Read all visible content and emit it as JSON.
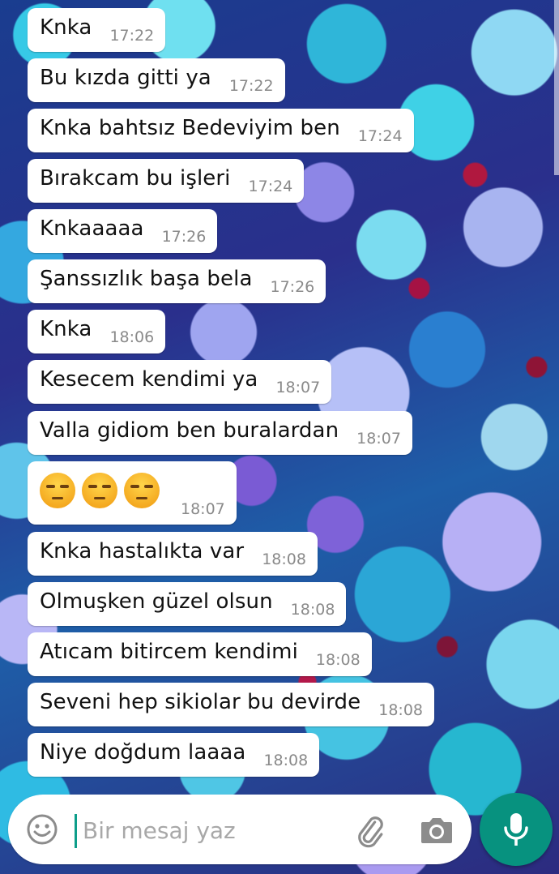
{
  "messages": [
    {
      "text": "Knka",
      "time": "17:22"
    },
    {
      "text": "Bu kızda gitti ya",
      "time": "17:22"
    },
    {
      "text": "Knka bahtsız Bedeviyim ben",
      "time": "17:24"
    },
    {
      "text": "Bırakcam bu işleri",
      "time": "17:24"
    },
    {
      "text": "Knkaaaaa",
      "time": "17:26"
    },
    {
      "text": "Şanssızlık başa bela",
      "time": "17:26"
    },
    {
      "text": "Knka",
      "time": "18:06"
    },
    {
      "text": "Kesecem kendimi ya",
      "time": "18:07"
    },
    {
      "text": "Valla gidiom ben buralardan",
      "time": "18:07"
    },
    {
      "text": "",
      "time": "18:07",
      "emoji": [
        "unamused-face",
        "unamused-face",
        "unamused-face"
      ]
    },
    {
      "text": "Knka hastalıkta var",
      "time": "18:08"
    },
    {
      "text": "Olmuşken güzel olsun",
      "time": "18:08"
    },
    {
      "text": "Atıcam bitircem kendimi",
      "time": "18:08"
    },
    {
      "text": "Seveni hep sikiolar bu devirde",
      "time": "18:08"
    },
    {
      "text": "Niye doğdum laaaa",
      "time": "18:08"
    }
  ],
  "composer": {
    "placeholder": "Bir mesaj yaz",
    "icons": [
      "smiley-icon",
      "attach-icon",
      "camera-icon",
      "mic-icon"
    ]
  },
  "colors": {
    "bubble": "#ffffff",
    "time": "#8a8a8a",
    "accent": "#07927f"
  }
}
